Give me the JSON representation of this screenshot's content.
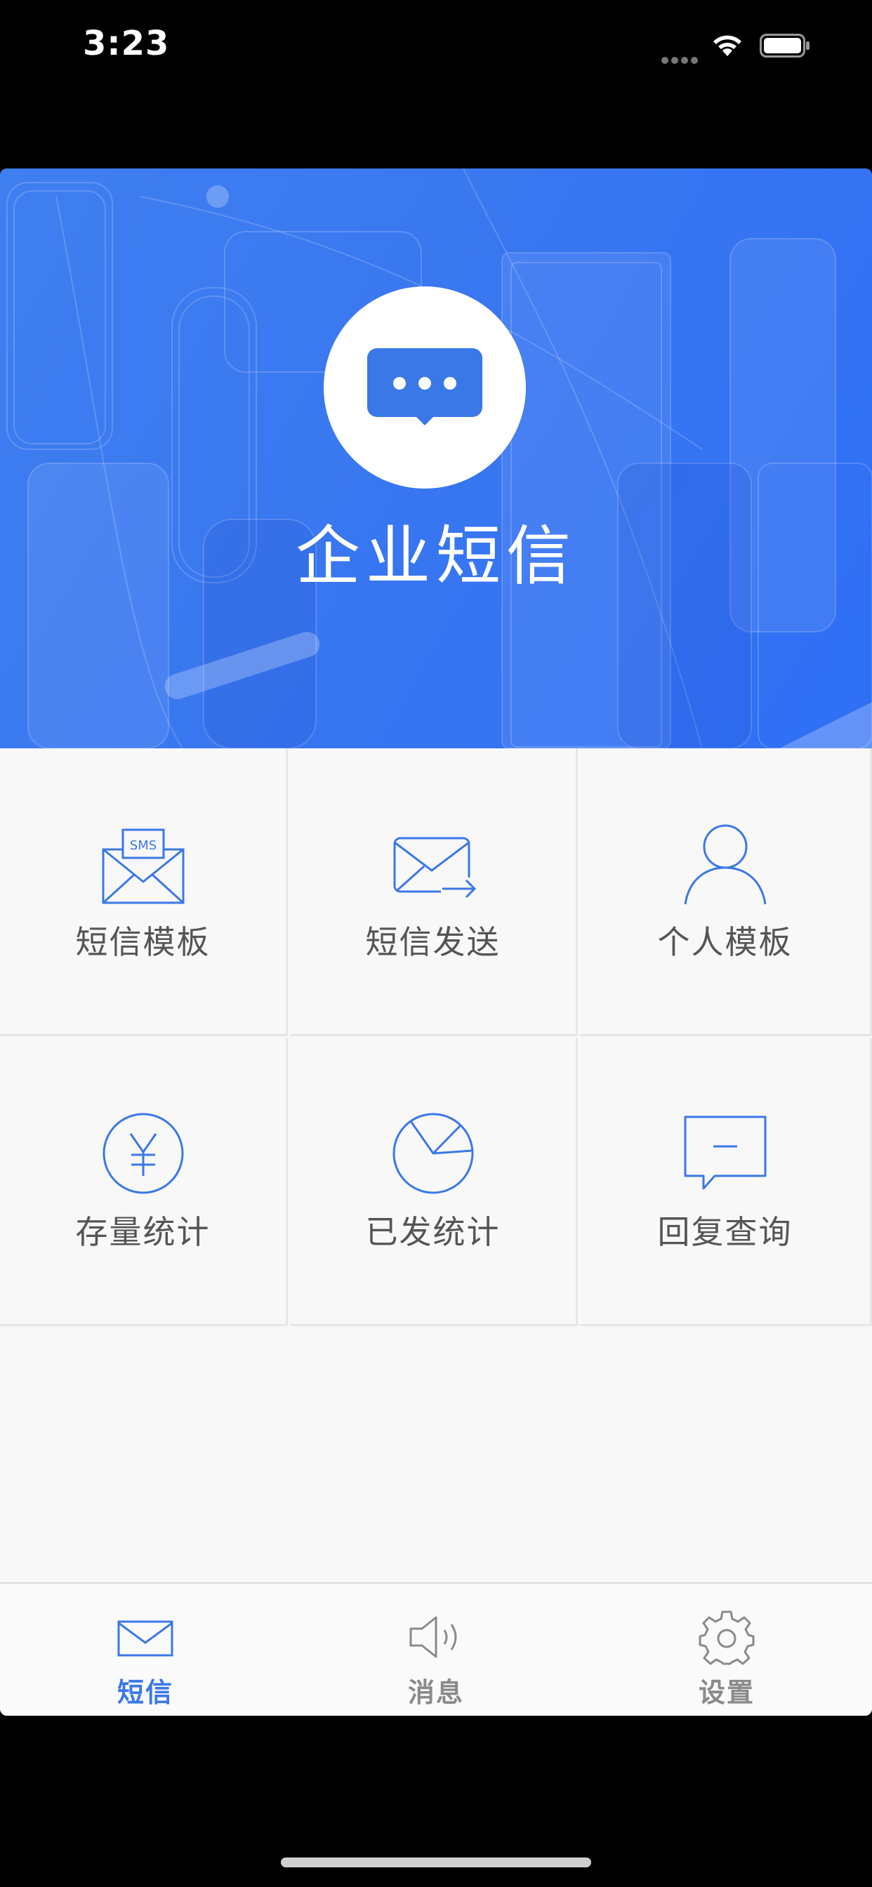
{
  "status_bar": {
    "time": "3:23"
  },
  "banner": {
    "title": "企业短信",
    "logo_icon": "chat-bubble-icon"
  },
  "grid": [
    {
      "label": "短信模板",
      "icon": "sms-envelope-icon"
    },
    {
      "label": "短信发送",
      "icon": "send-mail-icon"
    },
    {
      "label": "个人模板",
      "icon": "person-icon"
    },
    {
      "label": "存量统计",
      "icon": "yen-circle-icon"
    },
    {
      "label": "已发统计",
      "icon": "pie-chart-icon"
    },
    {
      "label": "回复查询",
      "icon": "reply-bubble-icon"
    }
  ],
  "tab_bar": {
    "items": [
      {
        "label": "短信",
        "icon": "mail-icon",
        "active": true
      },
      {
        "label": "消息",
        "icon": "speaker-icon",
        "active": false
      },
      {
        "label": "设置",
        "icon": "gear-icon",
        "active": false
      }
    ]
  },
  "colors": {
    "accent": "#3b78e7",
    "inactive": "#8a8a8a",
    "banner": "#3a78f0"
  }
}
